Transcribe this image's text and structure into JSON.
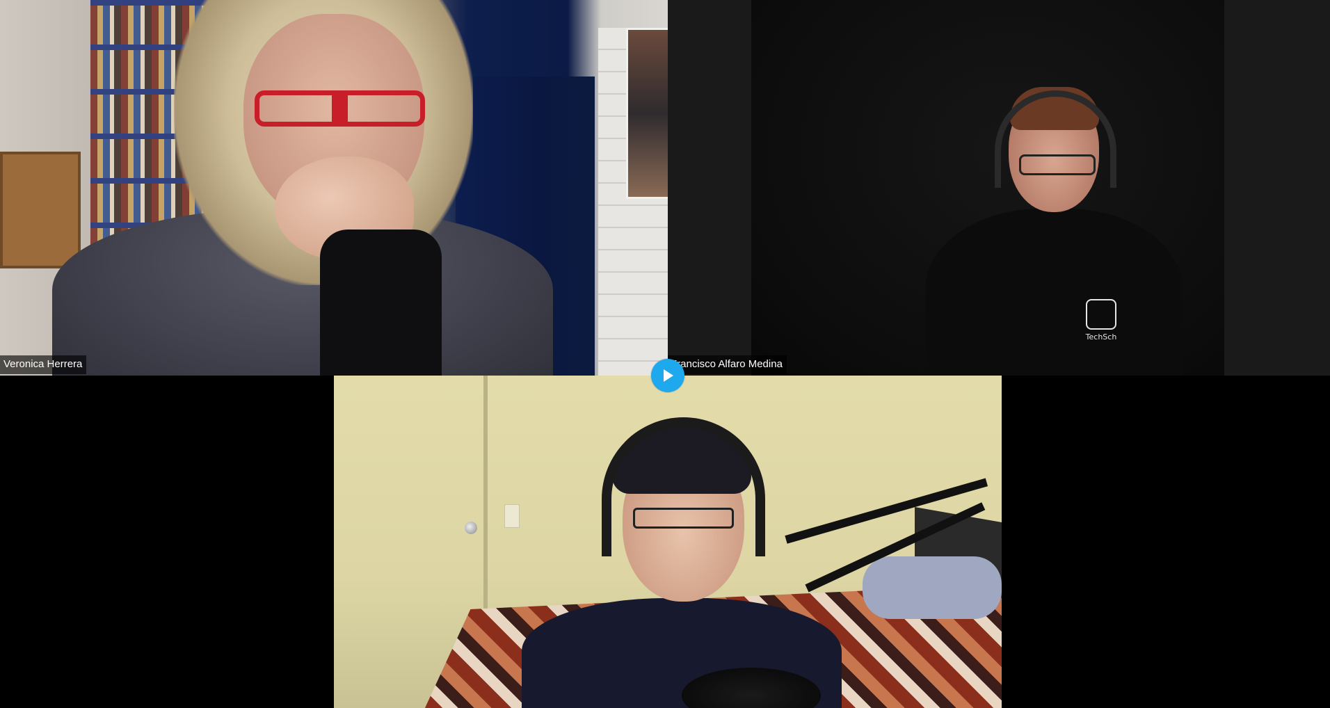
{
  "participants": [
    {
      "name": "Veronica Herrera"
    },
    {
      "name": "Francisco Alfaro Medina"
    },
    {
      "name": ""
    }
  ],
  "shirt_logo_text": "TechSch",
  "controls": {
    "play_icon": "play-icon",
    "accent_color": "#1ea8ee"
  }
}
